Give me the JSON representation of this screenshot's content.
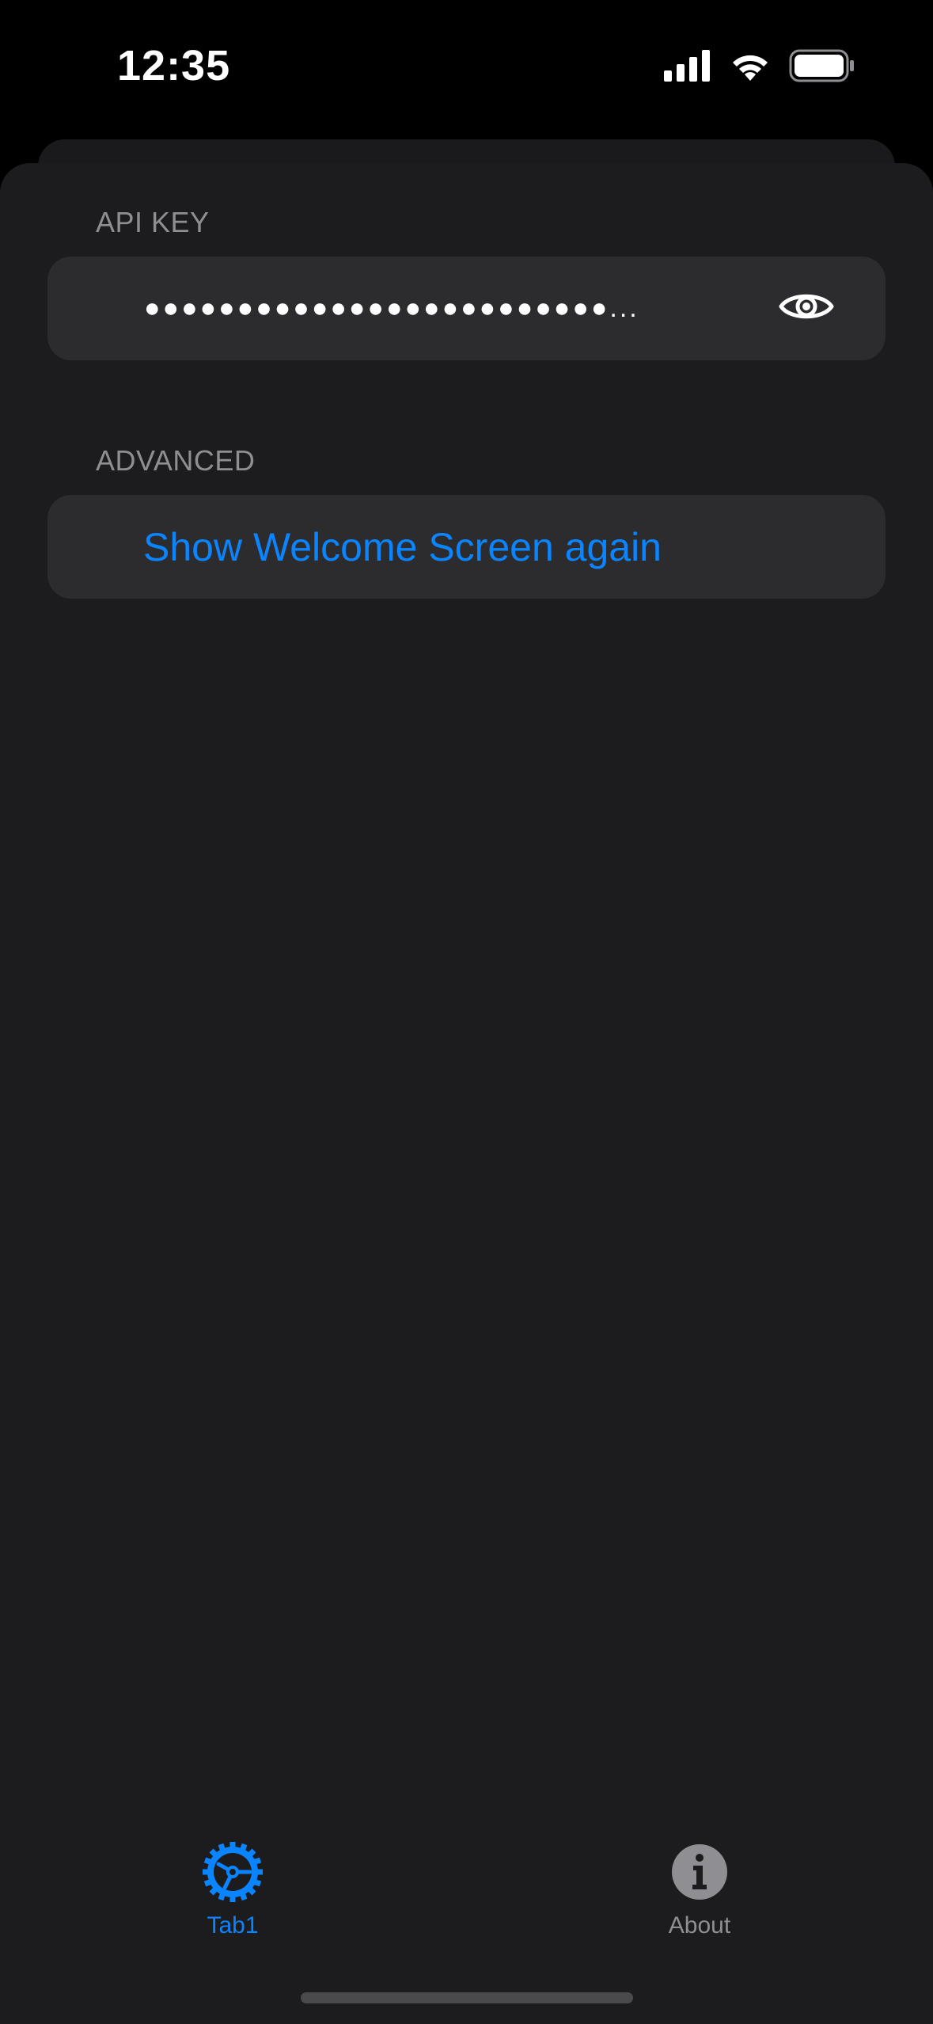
{
  "status_bar": {
    "time": "12:35"
  },
  "api_key_section": {
    "header": "API KEY",
    "masked_value": "●●●●●●●●●●●●●●●●●●●●●●●●●...",
    "reveal_icon": "eye-icon"
  },
  "advanced_section": {
    "header": "ADVANCED",
    "show_welcome_label": "Show Welcome Screen again"
  },
  "tab_bar": {
    "tabs": [
      {
        "label": "Tab1",
        "icon": "gear-icon",
        "selected": true
      },
      {
        "label": "About",
        "icon": "info-icon",
        "selected": false
      }
    ]
  },
  "colors": {
    "accent": "#0a84ff",
    "background": "#1c1c1e",
    "cell": "#2c2c2e",
    "secondary_text": "#8e8e93"
  }
}
